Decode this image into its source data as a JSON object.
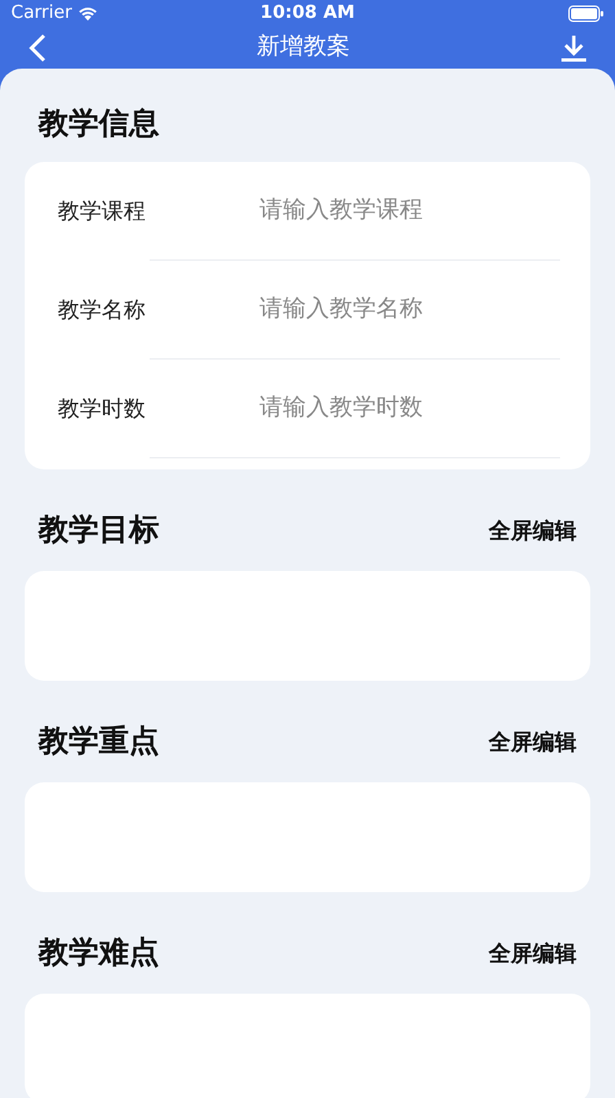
{
  "status_bar": {
    "carrier": "Carrier",
    "time": "10:08 AM"
  },
  "nav": {
    "title": "新增教案"
  },
  "info": {
    "title": "教学信息",
    "fields": [
      {
        "label": "教学课程",
        "placeholder": "请输入教学课程"
      },
      {
        "label": "教学名称",
        "placeholder": "请输入教学名称"
      },
      {
        "label": "教学时数",
        "placeholder": "请输入教学时数"
      }
    ]
  },
  "sections": [
    {
      "title": "教学目标",
      "action": "全屏编辑"
    },
    {
      "title": "教学重点",
      "action": "全屏编辑"
    },
    {
      "title": "教学难点",
      "action": "全屏编辑"
    }
  ]
}
